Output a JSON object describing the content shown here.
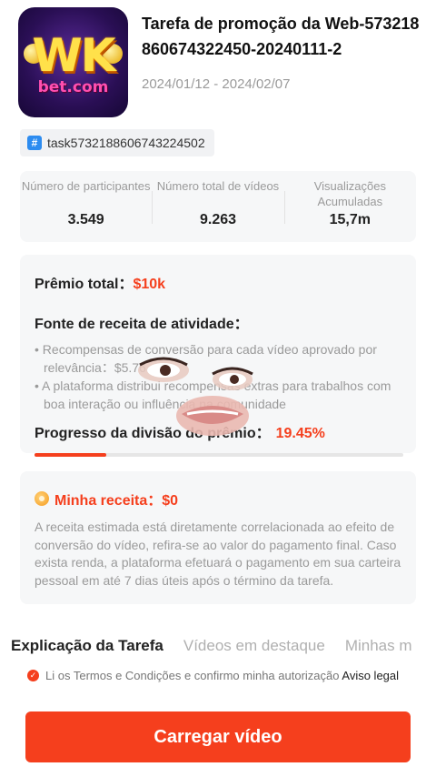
{
  "header": {
    "icon_text_top": "WK",
    "icon_text_bottom": "bet.com",
    "title": "Tarefa de promoção da Web-573218860674322450-20240111-2",
    "dates": "2024/01/12 - 2024/02/07"
  },
  "tag": {
    "icon": "#",
    "text": "task5732188606743224502"
  },
  "stats": [
    {
      "label": "Número de participantes",
      "value": "3.549"
    },
    {
      "label": "Número total de vídeos",
      "value": "9.263"
    },
    {
      "label": "Visualizações Acumuladas",
      "value": "15,7m"
    }
  ],
  "prize": {
    "label": "Prêmio total：",
    "value": "$10k",
    "source_title": "Fonte de receita de atividade：",
    "bullets": [
      "• Recompensas de conversão para cada vídeo aprovado por relevância：$5.76",
      "• A plataforma distribui recompensas extras para trabalhos com boa interação ou influência na comunidade"
    ],
    "progress_label": "Progresso da divisão do prêmio：",
    "progress_value": "19.45%",
    "progress_fraction": 0.1945
  },
  "revenue": {
    "title": "Minha receita：$0",
    "text": "A receita estimada está diretamente correlacionada ao efeito de conversão do vídeo, refira-se ao valor do pagamento final. Caso exista renda, a plataforma efetuará o pagamento em sua carteira pessoal em até 7 dias úteis após o término da tarefa."
  },
  "tabs": [
    "Explicação da Tarefa",
    "Vídeos em destaque",
    "Minhas m"
  ],
  "terms": {
    "text": "Li os Termos e Condições e confirmo minha autorização",
    "legal": "Aviso legal"
  },
  "upload_button": "Carregar vídeo",
  "colors": {
    "accent": "#f53f1d",
    "card_bg": "#f6f7f8",
    "tag_icon": "#2d8cf0"
  }
}
